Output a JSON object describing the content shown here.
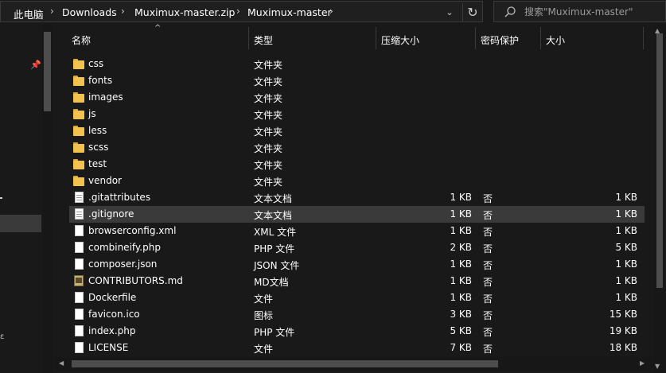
{
  "address": {
    "crumbs": [
      "此电脑",
      "Downloads",
      "Muximux-master.zip",
      "Muximux-master"
    ],
    "separator": "›",
    "dropdown_glyph": "⌄",
    "refresh_glyph": "↻"
  },
  "search": {
    "placeholder": "搜索\"Muximux-master\""
  },
  "columns": {
    "name": "名称",
    "type": "类型",
    "compressed": "压缩大小",
    "protected": "密码保护",
    "size": "大小",
    "sort_glyph": "^"
  },
  "files": [
    {
      "name": "css",
      "type": "文件夹",
      "compressed": "",
      "protected": "",
      "size": "",
      "icon": "folder-icon"
    },
    {
      "name": "fonts",
      "type": "文件夹",
      "compressed": "",
      "protected": "",
      "size": "",
      "icon": "folder-icon"
    },
    {
      "name": "images",
      "type": "文件夹",
      "compressed": "",
      "protected": "",
      "size": "",
      "icon": "folder-icon"
    },
    {
      "name": "js",
      "type": "文件夹",
      "compressed": "",
      "protected": "",
      "size": "",
      "icon": "folder-icon"
    },
    {
      "name": "less",
      "type": "文件夹",
      "compressed": "",
      "protected": "",
      "size": "",
      "icon": "folder-icon"
    },
    {
      "name": "scss",
      "type": "文件夹",
      "compressed": "",
      "protected": "",
      "size": "",
      "icon": "folder-icon"
    },
    {
      "name": "test",
      "type": "文件夹",
      "compressed": "",
      "protected": "",
      "size": "",
      "icon": "folder-icon"
    },
    {
      "name": "vendor",
      "type": "文件夹",
      "compressed": "",
      "protected": "",
      "size": "",
      "icon": "folder-icon"
    },
    {
      "name": ".gitattributes",
      "type": "文本文档",
      "compressed": "1 KB",
      "protected": "否",
      "size": "1 KB",
      "icon": "document-icon"
    },
    {
      "name": ".gitignore",
      "type": "文本文档",
      "compressed": "1 KB",
      "protected": "否",
      "size": "1 KB",
      "icon": "document-icon",
      "selected": true
    },
    {
      "name": "browserconfig.xml",
      "type": "XML 文件",
      "compressed": "1 KB",
      "protected": "否",
      "size": "1 KB",
      "icon": "file-icon"
    },
    {
      "name": "combineify.php",
      "type": "PHP 文件",
      "compressed": "2 KB",
      "protected": "否",
      "size": "5 KB",
      "icon": "file-icon"
    },
    {
      "name": "composer.json",
      "type": "JSON 文件",
      "compressed": "1 KB",
      "protected": "否",
      "size": "1 KB",
      "icon": "file-icon"
    },
    {
      "name": "CONTRIBUTORS.md",
      "type": "MD文档",
      "compressed": "1 KB",
      "protected": "否",
      "size": "1 KB",
      "icon": "markdown-file-icon"
    },
    {
      "name": "Dockerfile",
      "type": "文件",
      "compressed": "1 KB",
      "protected": "否",
      "size": "1 KB",
      "icon": "file-icon"
    },
    {
      "name": "favicon.ico",
      "type": "图标",
      "compressed": "3 KB",
      "protected": "否",
      "size": "15 KB",
      "icon": "file-icon"
    },
    {
      "name": "index.php",
      "type": "PHP 文件",
      "compressed": "5 KB",
      "protected": "否",
      "size": "19 KB",
      "icon": "file-icon"
    },
    {
      "name": "LICENSE",
      "type": "文件",
      "compressed": "7 KB",
      "protected": "否",
      "size": "18 KB",
      "icon": "file-icon"
    }
  ],
  "colors": {
    "background": "#191919",
    "selected_row": "#3a3a3a",
    "folder": "#f2c24e"
  }
}
